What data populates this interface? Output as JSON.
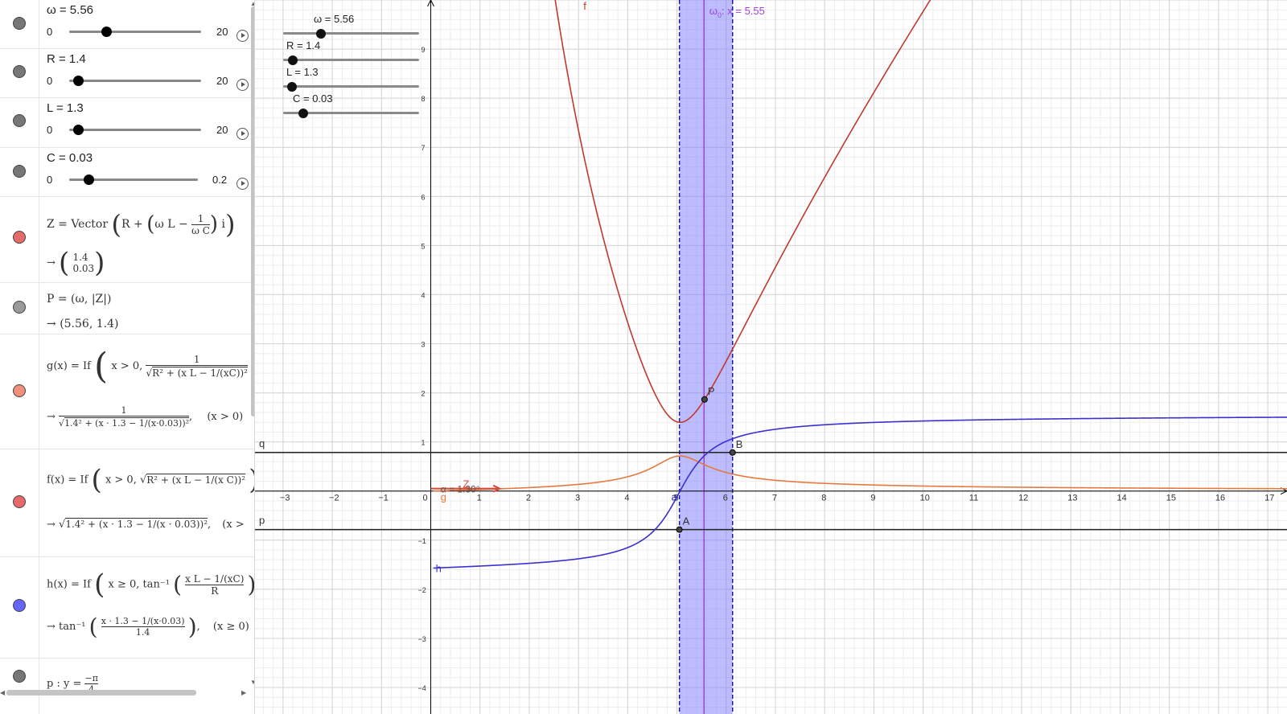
{
  "algebra": {
    "sliders": [
      {
        "name": "omega",
        "title": "ω = 5.56",
        "min": "0",
        "max": "20",
        "value": 5.56,
        "range": [
          0,
          20
        ]
      },
      {
        "name": "r",
        "title": "R = 1.4",
        "min": "0",
        "max": "20",
        "value": 1.4,
        "range": [
          0,
          20
        ]
      },
      {
        "name": "l",
        "title": "L = 1.3",
        "min": "0",
        "max": "20",
        "value": 1.3,
        "range": [
          0,
          20
        ]
      },
      {
        "name": "c",
        "title": "C = 0.03",
        "min": "0",
        "max": "0.2",
        "value": 0.03,
        "range": [
          0,
          0.2
        ]
      }
    ],
    "z": {
      "lhs": "Z = Vector",
      "inner_r": "R +",
      "inner_wl": "ω L −",
      "frac_num": "1",
      "frac_den": "ω C",
      "imag": "i",
      "result_arrow": "→",
      "result_top": "1.4",
      "result_bottom": "0.03"
    },
    "p": {
      "def": "P = (ω, |Z|)",
      "arrow": "→",
      "result": "(5.56, 1.4)"
    },
    "g": {
      "def": "g(x) = If",
      "cond": "x > 0,",
      "num": "1",
      "den": "R² + (x L − 1/(xC))²",
      "arrow": "→",
      "res_num": "1",
      "res_den": "1.4² + (x · 1.3 − 1/(x·0.03))²",
      "res_cond": "(x > 0)"
    },
    "f": {
      "def": "f(x) = If",
      "cond": "x > 0,",
      "body": "R² + (x L − 1/(x C))²",
      "arrow": "→",
      "res_body": "1.4² + (x · 1.3 − 1/(x · 0.03))²",
      "res_cond": "(x >"
    },
    "h": {
      "def": "h(x) = If",
      "cond": "x ≥ 0, tan⁻¹",
      "num": "x L − 1/(xC)",
      "den": "R",
      "arrow": "→",
      "res_fn": "tan⁻¹",
      "res_num": "x · 1.3 − 1/(x·0.03)",
      "res_den": "1.4",
      "res_cond": "(x ≥ 0)"
    },
    "pline": {
      "def": "p : y =",
      "num": "−π",
      "den": "4"
    },
    "marble_colors": {
      "slider": "#777777",
      "z": "#e76a6a",
      "p": "#9a9a9a",
      "g": "#f08f7a",
      "f": "#e76a6a",
      "h": "#6666ff",
      "pline": "#777777"
    }
  },
  "graphics": {
    "sliders": [
      {
        "label": "ω = 5.56",
        "value": 5.56,
        "range": [
          0,
          20
        ]
      },
      {
        "label": "R = 1.4",
        "value": 1.4,
        "range": [
          0,
          20
        ]
      },
      {
        "label": "L = 1.3",
        "value": 1.3,
        "range": [
          0,
          20
        ]
      },
      {
        "label": "C = 0.03",
        "value": 0.03,
        "range": [
          0,
          0.2
        ]
      }
    ],
    "x_ticks": [
      "−3",
      "−2",
      "−1",
      "0",
      "1",
      "2",
      "3",
      "4",
      "5",
      "6",
      "7",
      "8",
      "9",
      "10",
      "11",
      "12",
      "13",
      "14",
      "15",
      "16",
      "17"
    ],
    "y_ticks": [
      "−4",
      "−3",
      "−2",
      "−1",
      "1",
      "2",
      "3",
      "4",
      "5",
      "6",
      "7",
      "8",
      "9"
    ],
    "labels": {
      "f": "f",
      "g": "g",
      "h": "h",
      "p": "p",
      "q": "q",
      "Z": "Z",
      "alpha": "α = 1.30°",
      "P": "P",
      "A": "A",
      "B": "B",
      "a": "a",
      "omega0": "ω",
      "omega0_sub": "0",
      "omega0_rest": ": x = 5.55"
    },
    "colors": {
      "f": "#c0392b",
      "g": "#e8793e",
      "h": "#3b2fd0",
      "band": "#7a7aff",
      "omega0_line": "#a040e0",
      "axis": "#000000",
      "hline": "#222222",
      "z_vector": "#d84b3b"
    },
    "view": {
      "xmin": -3.57,
      "xmax": 17.39,
      "ymin": -4.54,
      "ymax": 10.0
    },
    "params": {
      "R": 1.4,
      "L": 1.3,
      "C": 0.03,
      "omega": 5.56,
      "band_left": 5.05,
      "band_right": 6.13,
      "p_y": -0.785,
      "q_y": 0.785
    }
  }
}
